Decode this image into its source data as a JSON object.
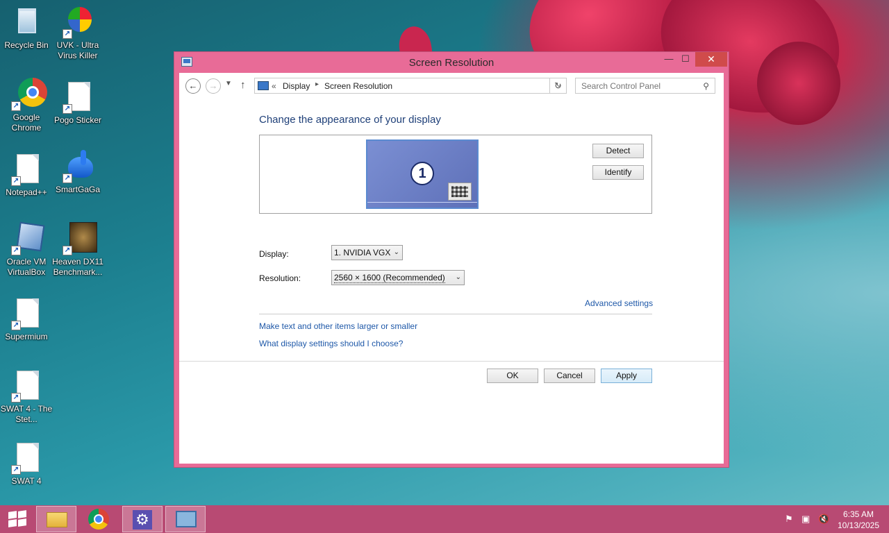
{
  "desktop": {
    "icons": [
      {
        "label": "Recycle Bin"
      },
      {
        "label": "UVK - Ultra Virus Killer"
      },
      {
        "label": "Google Chrome"
      },
      {
        "label": "Pogo Sticker"
      },
      {
        "label": "Notepad++"
      },
      {
        "label": "SmartGaGa"
      },
      {
        "label": "Oracle VM VirtualBox"
      },
      {
        "label": "Heaven DX11 Benchmark..."
      },
      {
        "label": "Supermium"
      },
      {
        "label": "SWAT 4 - The Stet..."
      },
      {
        "label": "SWAT 4"
      }
    ]
  },
  "window": {
    "title": "Screen Resolution",
    "controls": {
      "minimize": "—",
      "maximize": "☐",
      "close": "✕"
    }
  },
  "nav": {
    "back": "←",
    "forward": "→",
    "recent": "▼",
    "up": "↑",
    "address": {
      "overflow": "«",
      "crumbs": [
        "Display",
        "Screen Resolution"
      ],
      "separator": "▸",
      "dropdown": "⌄"
    },
    "refresh": "↻",
    "search_placeholder": "Search Control Panel",
    "search_icon": "⚲"
  },
  "content": {
    "heading": "Change the appearance of your display",
    "monitor_number": "1",
    "detect_label": "Detect",
    "identify_label": "Identify",
    "display_label": "Display:",
    "display_value": "1. NVIDIA VGX",
    "resolution_label": "Resolution:",
    "resolution_value": "2560 × 1600 (Recommended)",
    "advanced_link": "Advanced settings",
    "link_text_size": "Make text and other items larger or smaller",
    "link_which_settings": "What display settings should I choose?",
    "ok_label": "OK",
    "cancel_label": "Cancel",
    "apply_label": "Apply"
  },
  "taskbar": {
    "clock_time": "6:35 AM",
    "clock_date": "10/13/2025",
    "tray_flag": "⚑",
    "tray_network": "▣",
    "tray_volume": "🔇",
    "settings_glyph": "⚙"
  },
  "colors": {
    "window_frame": "#e86b97",
    "taskbar": "#b84a73",
    "link": "#1e58a8",
    "heading": "#1e3f78"
  }
}
